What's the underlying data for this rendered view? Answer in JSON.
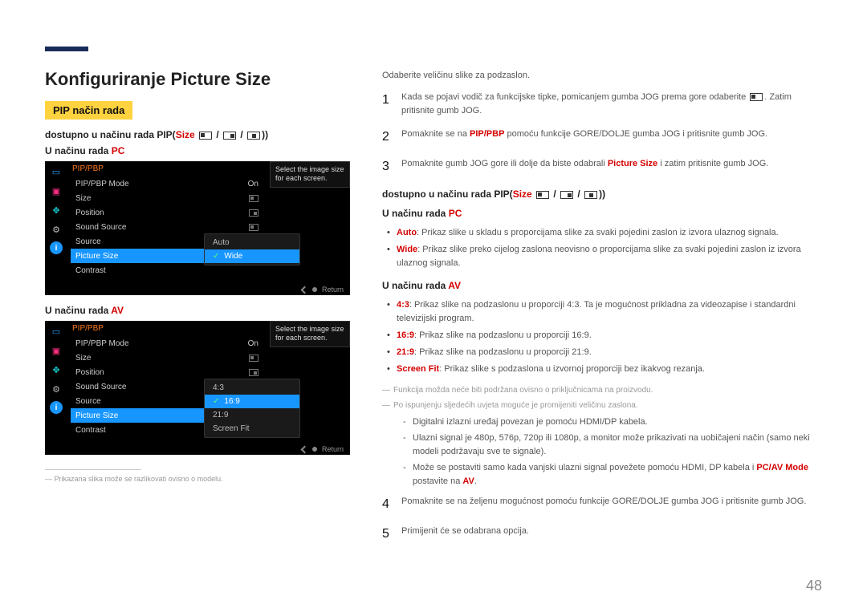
{
  "page": {
    "number": "48"
  },
  "header": {
    "title": "Konfiguriranje Picture Size",
    "pip_badge": "PIP način rada",
    "avail_prefix": "dostupno u načinu rada PIP(",
    "avail_size": "Size",
    "avail_suffix": "))"
  },
  "left": {
    "mode_pc": "U načinu rada ",
    "pc": "PC",
    "mode_av": "U načinu rada ",
    "av": "AV",
    "footnote_sep": " ",
    "footnote": "Prikazana slika može se razlikovati ovisno o modelu."
  },
  "panel": {
    "title": "PIP/PBP",
    "hint": "Select the image size for each screen.",
    "rows": {
      "mode": {
        "label": "PIP/PBP Mode",
        "value": "On"
      },
      "size": {
        "label": "Size",
        "value": ""
      },
      "position": {
        "label": "Position",
        "value": ""
      },
      "sound": {
        "label": "Sound Source",
        "value": ""
      },
      "source": {
        "label": "Source",
        "value": "-"
      },
      "picsize": {
        "label": "Picture Size",
        "value": ""
      },
      "contrast": {
        "label": "Contrast",
        "value": ""
      }
    },
    "submenu_pc": {
      "opt1": "Auto",
      "opt2": "Wide"
    },
    "submenu_av": {
      "opt1": "4:3",
      "opt2": "16:9",
      "opt3": "21:9",
      "opt4": "Screen Fit"
    },
    "return": "Return"
  },
  "right": {
    "lead": "Odaberite veličinu slike za podzaslon.",
    "step1_a": "Kada se pojavi vodič za funkcijske tipke, pomicanjem gumba JOG prema gore odaberite ",
    "step1_b": ". Zatim pritisnite gumb JOG.",
    "step2_a": "Pomaknite se na ",
    "step2_red": "PIP/PBP",
    "step2_b": " pomoću funkcije GORE/DOLJE gumba JOG i pritisnite gumb JOG.",
    "step3_a": "Pomaknite gumb JOG gore ili dolje da biste odabrali ",
    "step3_red": "Picture Size",
    "step3_b": " i zatim pritisnite gumb JOG.",
    "avail_prefix": "dostupno u načinu rada PIP(",
    "avail_size": "Size",
    "avail_suffix": "))",
    "sec_pc": "U načinu rada ",
    "pc": "PC",
    "pc_list": {
      "auto_b": "Auto",
      "auto": ": Prikaz slike u skladu s proporcijama slike za svaki pojedini zaslon iz izvora ulaznog signala.",
      "wide_b": "Wide",
      "wide": ": Prikaz slike preko cijelog zaslona neovisno o proporcijama slike za svaki pojedini zaslon iz izvora ulaznog signala."
    },
    "sec_av": "U načinu rada ",
    "av": "AV",
    "av_list": {
      "r43_b": "4:3",
      "r43": ": Prikaz slike na podzaslonu u proporciji 4:3. Ta je mogućnost prikladna za videozapise i standardni televizijski program.",
      "r169_b": "16:9",
      "r169": ": Prikaz slike na podzaslonu u proporciji 16:9.",
      "r219_b": "21:9",
      "r219": ": Prikaz slike na podzaslonu u proporciji 21:9.",
      "sf_b": "Screen Fit",
      "sf": ": Prikaz slike s podzaslona u izvornoj proporciji bez ikakvog rezanja."
    },
    "note1": "Funkcija možda neće biti podržana ovisno o priključnicama na proizvodu.",
    "note2": "Po ispunjenju sljedećih uvjeta moguće je promijeniti veličinu zaslona.",
    "dash1": "Digitalni izlazni uređaj povezan je pomoću HDMI/DP kabela.",
    "dash2": "Ulazni signal je 480p, 576p, 720p ili 1080p, a monitor može prikazivati na uobičajeni način (samo neki modeli podržavaju sve te signale).",
    "dash3_a": "Može se postaviti samo kada vanjski ulazni signal povežete pomoću HDMI, DP kabela i ",
    "dash3_red1": "PC/AV Mode",
    "dash3_b": " postavite na ",
    "dash3_red2": "AV",
    "dash3_c": ".",
    "step4": "Pomaknite se na željenu mogućnost pomoću funkcije GORE/DOLJE gumba JOG i pritisnite gumb JOG.",
    "step5": "Primijenit će se odabrana opcija."
  }
}
